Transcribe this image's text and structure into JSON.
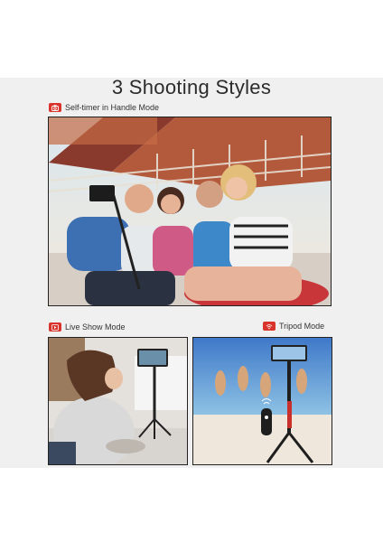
{
  "page": {
    "title": "3 Shooting Styles"
  },
  "sections": [
    {
      "label": "Self-timer in Handle Mode",
      "icon": "camera-icon"
    },
    {
      "label": "Live Show Mode",
      "icon": "play-icon"
    },
    {
      "label": "Tripod Mode",
      "icon": "wifi-icon"
    }
  ],
  "colors": {
    "accent": "#d9342b",
    "panel_bg": "#f0f0f0"
  }
}
